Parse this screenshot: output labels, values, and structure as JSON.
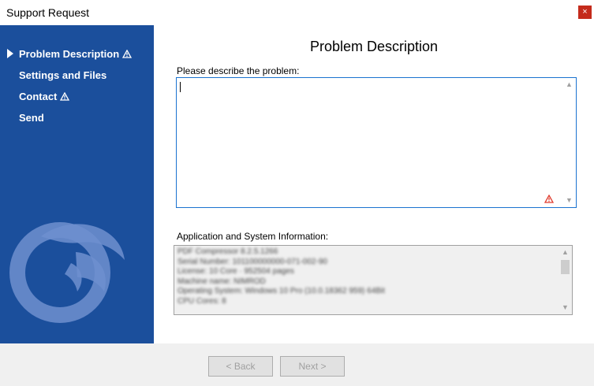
{
  "window": {
    "title": "Support Request",
    "close_glyph": "×"
  },
  "sidebar": {
    "items": [
      {
        "label": "Problem Description",
        "active": true,
        "warning": true
      },
      {
        "label": "Settings and Files",
        "active": false,
        "warning": false
      },
      {
        "label": "Contact",
        "active": false,
        "warning": true
      },
      {
        "label": "Send",
        "active": false,
        "warning": false
      }
    ],
    "logo": "swirl-logo-icon"
  },
  "main": {
    "heading": "Problem Description",
    "describe_label": "Please describe the problem:",
    "describe_value": "",
    "sysinfo_label": "Application and System Information:",
    "sysinfo_lines": [
      "PDF Compressor 8.2.5.1266",
      "Serial Number: 101100000000-071-002-90",
      "License: 10 Core · 952504 pages",
      "Machine name: NIMROD",
      "Operating System: Windows 10 Pro (10.0.18362 959) 64Bit",
      "CPU Cores: 8"
    ]
  },
  "footer": {
    "back_label": "< Back",
    "next_label": "Next >"
  },
  "colors": {
    "sidebar": "#1b4f9c",
    "accent": "#1a73d0",
    "warning": "#e03b2d"
  }
}
